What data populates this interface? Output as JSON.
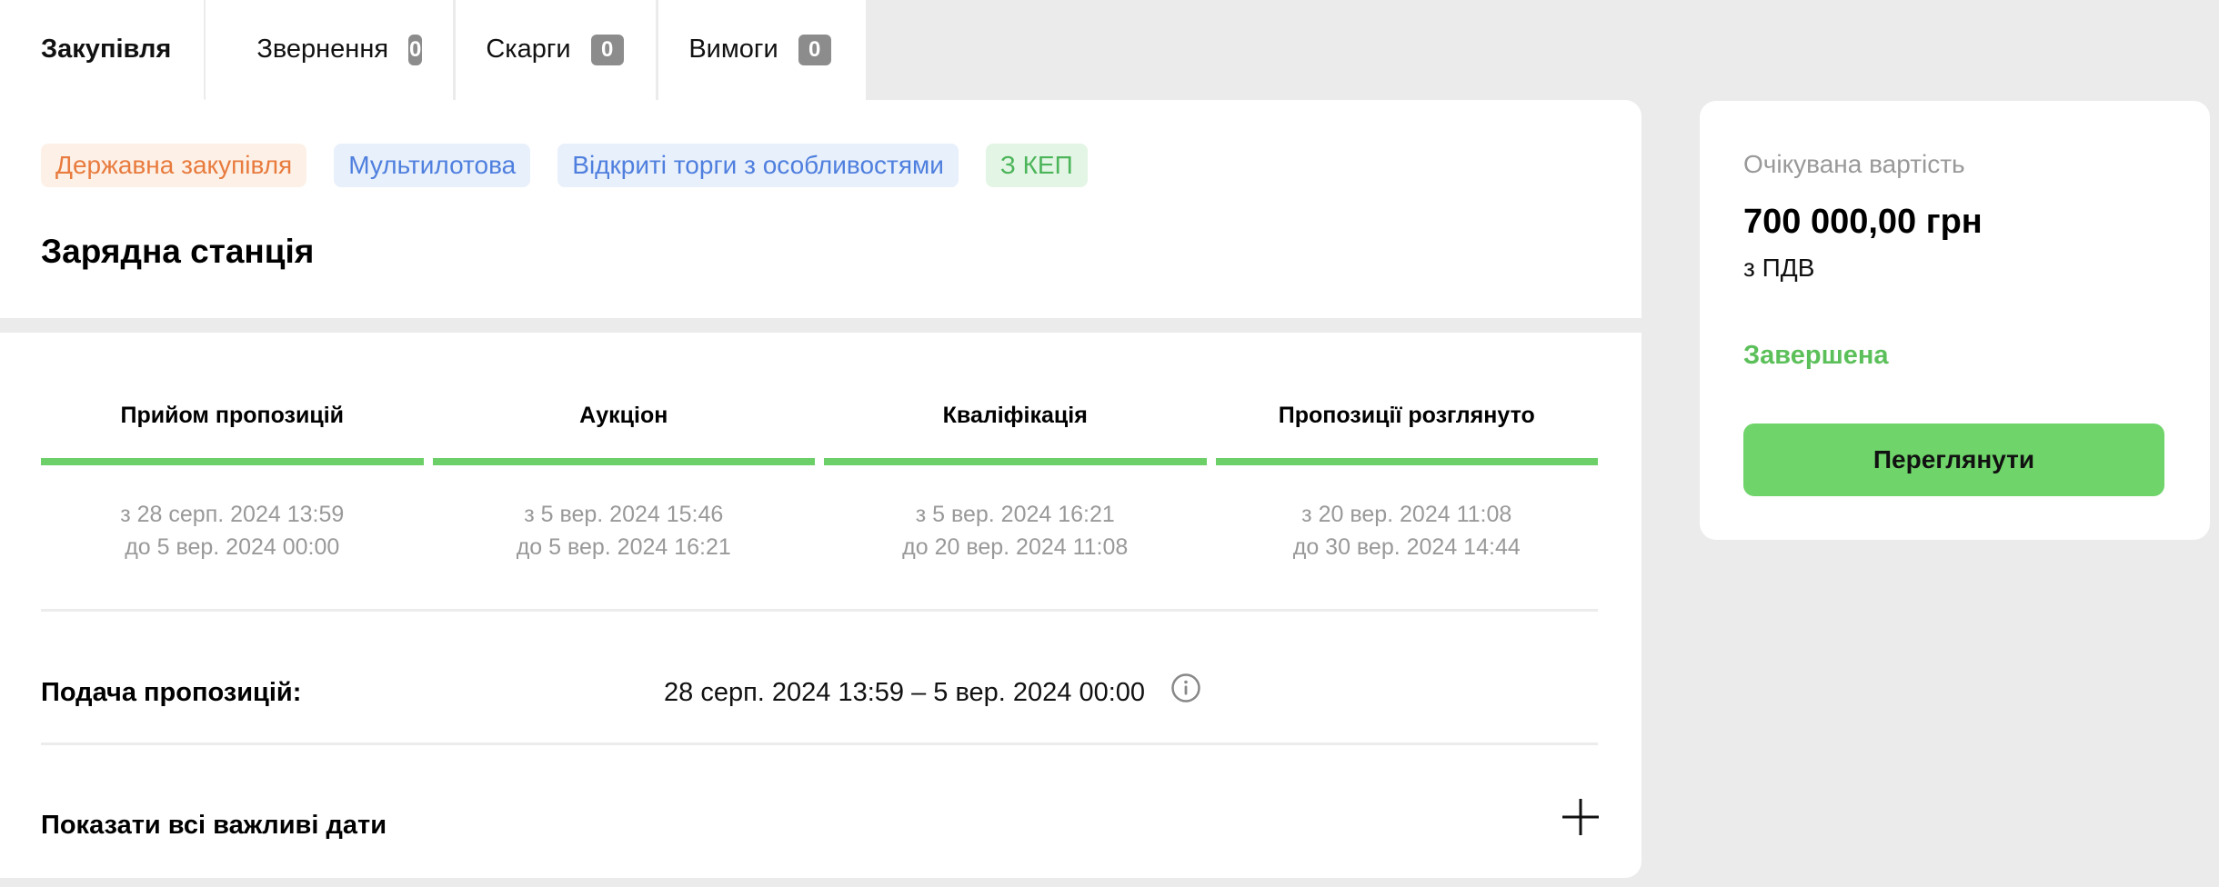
{
  "tabs": [
    {
      "label": "Закупівля"
    },
    {
      "label": "Звернення",
      "count": "0"
    },
    {
      "label": "Скарги",
      "count": "0"
    },
    {
      "label": "Вимоги",
      "count": "0"
    }
  ],
  "tags": [
    {
      "label": "Державна закупівля",
      "color": "#e87b3e"
    },
    {
      "label": "Мультилотова",
      "color": "#4f7fde"
    },
    {
      "label": "Відкриті торги з особливостями",
      "color": "#4f7fde"
    },
    {
      "label": "З КЕП",
      "color": "#4cb55a"
    }
  ],
  "procurement_title": "Зарядна станція",
  "stages": [
    {
      "title": "Прийом пропозицій",
      "from": "з 28 серп. 2024 13:59",
      "to": "до 5 вер. 2024 00:00"
    },
    {
      "title": "Аукціон",
      "from": "з 5 вер. 2024 15:46",
      "to": "до 5 вер. 2024 16:21"
    },
    {
      "title": "Кваліфікація",
      "from": "з 5 вер. 2024 16:21",
      "to": "до 20 вер. 2024 11:08"
    },
    {
      "title": "Пропозиції розглянуто",
      "from": "з 20 вер. 2024 11:08",
      "to": "до 30 вер. 2024 14:44"
    }
  ],
  "submission": {
    "label": "Подача пропозицій:",
    "value": "28 серп. 2024 13:59 – 5 вер. 2024 00:00"
  },
  "show_dates_label": "Показати всі важливі дати",
  "sidebar": {
    "expected_label": "Очікувана вартість",
    "expected_value": "700 000,00 грн",
    "vat": "з ПДВ",
    "status": "Завершена",
    "view_button": "Переглянути"
  },
  "colors": {
    "accent_green": "#6fd46a",
    "status_green": "#5cc05a",
    "background": "#ebebeb"
  }
}
